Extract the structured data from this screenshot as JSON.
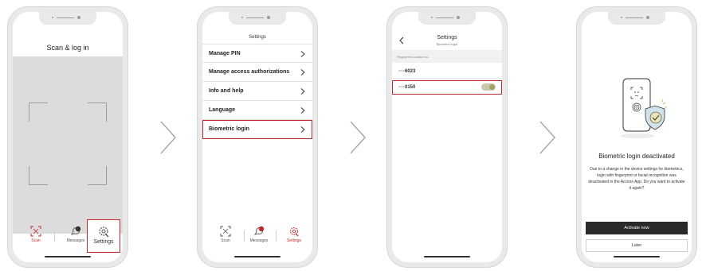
{
  "screen1": {
    "title": "Scan & log in",
    "tabs": [
      {
        "label": "Scan",
        "icon": "scan-icon",
        "active": true
      },
      {
        "label": "Messages",
        "icon": "messages-icon",
        "badge": "1"
      },
      {
        "label": "Settings",
        "icon": "settings-icon"
      }
    ]
  },
  "screen2": {
    "title": "Settings",
    "menu": [
      {
        "label": "Manage PIN"
      },
      {
        "label": "Manage access authorizations"
      },
      {
        "label": "Info and help"
      },
      {
        "label": "Language"
      },
      {
        "label": "Biometric login",
        "selected": true
      }
    ],
    "tabs": [
      {
        "label": "Scan",
        "icon": "scan-icon"
      },
      {
        "label": "Messages",
        "icon": "messages-icon",
        "badge": "1"
      },
      {
        "label": "Settings",
        "icon": "settings-icon",
        "active": true
      }
    ]
  },
  "screen3": {
    "title": "Settings",
    "subtitle": "Biometric login",
    "section_label": "Registered contact no.",
    "contacts": [
      {
        "number": "····6023",
        "toggle_on": false
      },
      {
        "number": "····0150",
        "toggle_on": true,
        "selected": true
      }
    ]
  },
  "screen4": {
    "heading": "Biometric login deactivated",
    "description": "Due to a change in the device settings for biometrics, login with fingerprint or facial recognition was deactivated in the Access App. Do you want to activate it again?",
    "primary_button": "Activate now",
    "secondary_button": "Later"
  },
  "colors": {
    "highlight": "#c0282d",
    "primary_button": "#2a2a2a",
    "toggle_knob": "#a5a162"
  }
}
